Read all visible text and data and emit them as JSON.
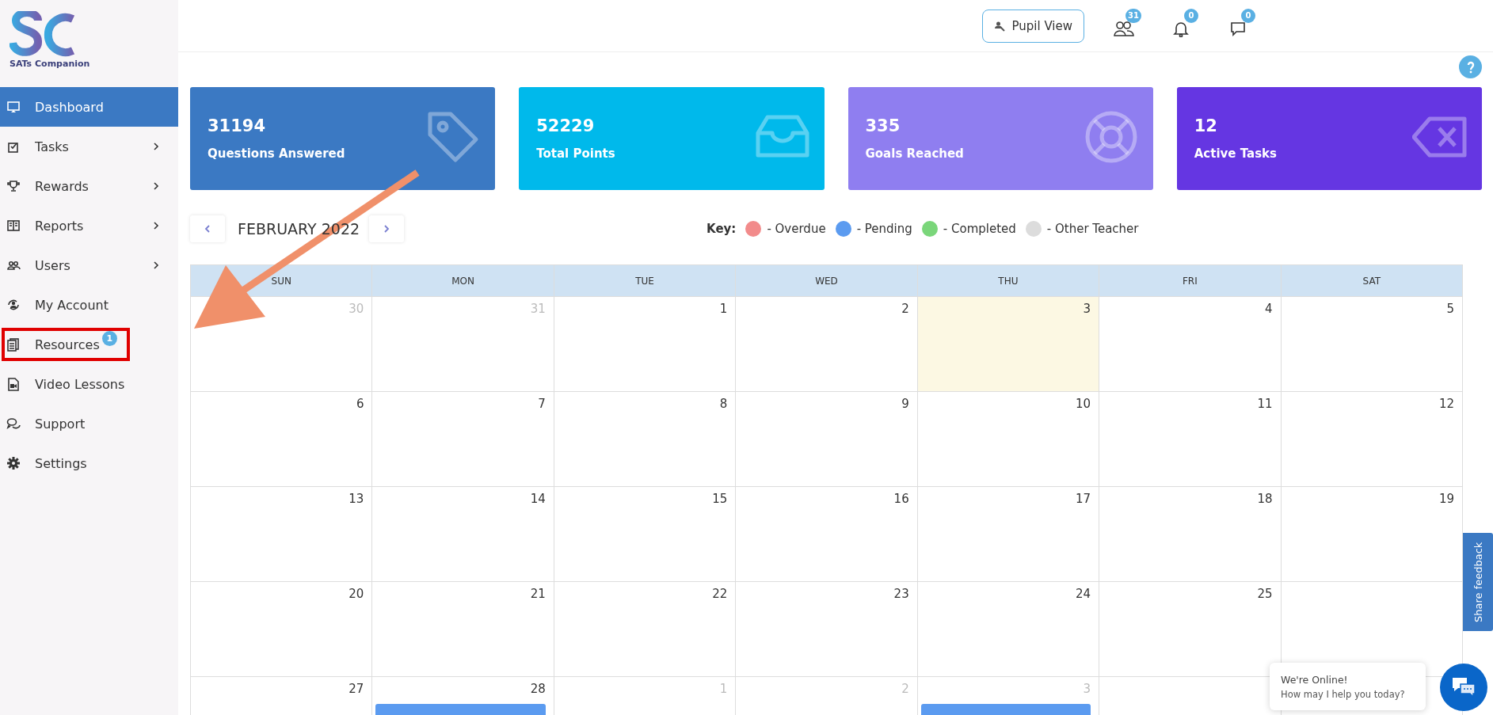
{
  "brand": {
    "name": "SATs Companion"
  },
  "sidebar": {
    "items": [
      {
        "label": "Dashboard",
        "selected": true,
        "submenu": false
      },
      {
        "label": "Tasks",
        "selected": false,
        "submenu": true
      },
      {
        "label": "Rewards",
        "selected": false,
        "submenu": true
      },
      {
        "label": "Reports",
        "selected": false,
        "submenu": true
      },
      {
        "label": "Users",
        "selected": false,
        "submenu": true
      },
      {
        "label": "My Account",
        "selected": false,
        "submenu": false
      },
      {
        "label": "Resources",
        "selected": false,
        "submenu": false,
        "badge": "1",
        "highlighted": true
      },
      {
        "label": "Video Lessons",
        "selected": false,
        "submenu": false
      },
      {
        "label": "Support",
        "selected": false,
        "submenu": false
      },
      {
        "label": "Settings",
        "selected": false,
        "submenu": false
      }
    ]
  },
  "header": {
    "pupil_view": "Pupil View",
    "users_count": "31",
    "notifications_count": "0",
    "messages_count": "0"
  },
  "stats": [
    {
      "value": "31194",
      "label": "Questions Answered",
      "color": "#3b79c3"
    },
    {
      "value": "52229",
      "label": "Total Points",
      "color": "#00b9eb"
    },
    {
      "value": "335",
      "label": "Goals Reached",
      "color": "#8f7ef0"
    },
    {
      "value": "12",
      "label": "Active Tasks",
      "color": "#6536e2"
    }
  ],
  "calendar": {
    "month": "FEBRUARY 2022",
    "key_label": "Key:",
    "key": [
      {
        "label": "- Overdue",
        "color": "#f28b8b"
      },
      {
        "label": "- Pending",
        "color": "#5b9bf0"
      },
      {
        "label": "- Completed",
        "color": "#7ad67a"
      },
      {
        "label": "- Other Teacher",
        "color": "#dcdcdc"
      }
    ],
    "weekdays": [
      "SUN",
      "MON",
      "TUE",
      "WED",
      "THU",
      "FRI",
      "SAT"
    ],
    "weeks": [
      [
        {
          "day": "30",
          "muted": true,
          "today": false
        },
        {
          "day": "31",
          "muted": true,
          "today": false
        },
        {
          "day": "1",
          "muted": false,
          "today": false
        },
        {
          "day": "2",
          "muted": false,
          "today": false
        },
        {
          "day": "3",
          "muted": false,
          "today": true
        },
        {
          "day": "4",
          "muted": false,
          "today": false
        },
        {
          "day": "5",
          "muted": false,
          "today": false
        }
      ],
      [
        {
          "day": "6",
          "muted": false,
          "today": false
        },
        {
          "day": "7",
          "muted": false,
          "today": false
        },
        {
          "day": "8",
          "muted": false,
          "today": false
        },
        {
          "day": "9",
          "muted": false,
          "today": false
        },
        {
          "day": "10",
          "muted": false,
          "today": false
        },
        {
          "day": "11",
          "muted": false,
          "today": false
        },
        {
          "day": "12",
          "muted": false,
          "today": false
        }
      ],
      [
        {
          "day": "13",
          "muted": false,
          "today": false
        },
        {
          "day": "14",
          "muted": false,
          "today": false
        },
        {
          "day": "15",
          "muted": false,
          "today": false
        },
        {
          "day": "16",
          "muted": false,
          "today": false
        },
        {
          "day": "17",
          "muted": false,
          "today": false
        },
        {
          "day": "18",
          "muted": false,
          "today": false
        },
        {
          "day": "19",
          "muted": false,
          "today": false
        }
      ],
      [
        {
          "day": "20",
          "muted": false,
          "today": false
        },
        {
          "day": "21",
          "muted": false,
          "today": false
        },
        {
          "day": "22",
          "muted": false,
          "today": false
        },
        {
          "day": "23",
          "muted": false,
          "today": false
        },
        {
          "day": "24",
          "muted": false,
          "today": false
        },
        {
          "day": "25",
          "muted": false,
          "today": false
        },
        {
          "today": false
        }
      ],
      [
        {
          "day": "27",
          "muted": false,
          "today": false
        },
        {
          "day": "28",
          "muted": false,
          "today": false,
          "events": [
            {
              "color": "#5b9bf0"
            }
          ]
        },
        {
          "day": "1",
          "muted": true,
          "today": false
        },
        {
          "day": "2",
          "muted": true,
          "today": false
        },
        {
          "day": "3",
          "muted": true,
          "today": false,
          "events": [
            {
              "color": "#5b9bf0"
            }
          ]
        },
        {
          "today": false
        },
        {
          "today": false
        }
      ]
    ]
  },
  "feedback_tab": "Share feedback",
  "chat": {
    "title": "We're Online!",
    "subtitle": "How may I help you today?"
  }
}
